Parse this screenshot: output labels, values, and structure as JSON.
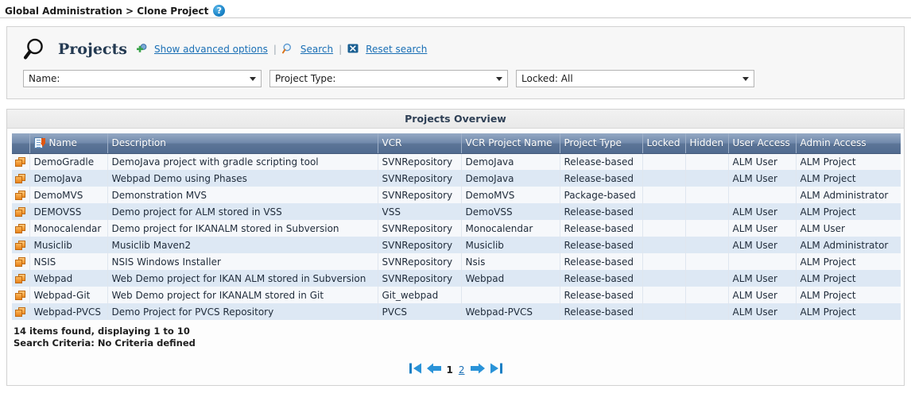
{
  "breadcrumb": {
    "text": "Global Administration > Clone Project",
    "help_icon": "help-icon",
    "help_glyph": "?"
  },
  "search_panel": {
    "icon": "magnifier-icon",
    "title": "Projects",
    "advanced_link": "Show advanced options",
    "advanced_icon": "add-options-icon",
    "separator": "|",
    "search_link": "Search",
    "search_icon": "search-icon",
    "reset_link": "Reset search",
    "reset_icon": "reset-icon",
    "filters": [
      {
        "name": "name-filter",
        "value": "Name:"
      },
      {
        "name": "project-type-filter",
        "value": "Project Type:"
      },
      {
        "name": "locked-filter",
        "value": "Locked: All"
      }
    ]
  },
  "results": {
    "title": "Projects Overview",
    "columns": [
      "",
      "Name",
      "Description",
      "VCR",
      "VCR Project Name",
      "Project Type",
      "Locked",
      "Hidden",
      "User Access",
      "Admin Access"
    ],
    "sort_column": "Name",
    "sort_icon": "sort-descending-icon",
    "row_icon": "clone-project-icon",
    "rows": [
      {
        "name": "DemoGradle",
        "description": "DemoJava project with gradle scripting tool",
        "vcr": "SVNRepository",
        "vcr_project_name": "DemoJava",
        "project_type": "Release-based",
        "locked": "",
        "hidden": "",
        "user_access": "ALM User",
        "admin_access": "ALM Project"
      },
      {
        "name": "DemoJava",
        "description": "Webpad Demo using Phases",
        "vcr": "SVNRepository",
        "vcr_project_name": "DemoJava",
        "project_type": "Release-based",
        "locked": "",
        "hidden": "",
        "user_access": "ALM User",
        "admin_access": "ALM Project"
      },
      {
        "name": "DemoMVS",
        "description": "Demonstration MVS",
        "vcr": "SVNRepository",
        "vcr_project_name": "DemoMVS",
        "project_type": "Package-based",
        "locked": "",
        "hidden": "",
        "user_access": "",
        "admin_access": "ALM Administrator"
      },
      {
        "name": "DEMOVSS",
        "description": "Demo project for ALM stored in VSS",
        "vcr": "VSS",
        "vcr_project_name": "DemoVSS",
        "project_type": "Release-based",
        "locked": "",
        "hidden": "",
        "user_access": "ALM User",
        "admin_access": "ALM Project"
      },
      {
        "name": "Monocalendar",
        "description": "Demo project for IKANALM stored in Subversion",
        "vcr": "SVNRepository",
        "vcr_project_name": "Monocalendar",
        "project_type": "Release-based",
        "locked": "",
        "hidden": "",
        "user_access": "ALM User",
        "admin_access": "ALM User"
      },
      {
        "name": "Musiclib",
        "description": "Musiclib Maven2",
        "vcr": "SVNRepository",
        "vcr_project_name": "Musiclib",
        "project_type": "Release-based",
        "locked": "",
        "hidden": "",
        "user_access": "ALM User",
        "admin_access": "ALM Administrator"
      },
      {
        "name": "NSIS",
        "description": "NSIS Windows Installer",
        "vcr": "SVNRepository",
        "vcr_project_name": "Nsis",
        "project_type": "Release-based",
        "locked": "",
        "hidden": "",
        "user_access": "",
        "admin_access": "ALM Project"
      },
      {
        "name": "Webpad",
        "description": "Web Demo project for IKAN ALM stored in Subversion",
        "vcr": "SVNRepository",
        "vcr_project_name": "Webpad",
        "project_type": "Release-based",
        "locked": "",
        "hidden": "",
        "user_access": "ALM User",
        "admin_access": "ALM Project"
      },
      {
        "name": "Webpad-Git",
        "description": "Web Demo project for IKANALM stored in Git",
        "vcr": "Git_webpad",
        "vcr_project_name": "",
        "project_type": "Release-based",
        "locked": "",
        "hidden": "",
        "user_access": "ALM User",
        "admin_access": "ALM Project"
      },
      {
        "name": "Webpad-PVCS",
        "description": "Demo Project for PVCS Repository",
        "vcr": "PVCS",
        "vcr_project_name": "Webpad-PVCS",
        "project_type": "Release-based",
        "locked": "",
        "hidden": "",
        "user_access": "ALM User",
        "admin_access": "ALM Project"
      }
    ],
    "footer": {
      "items_found": "14 items found, displaying 1 to 10",
      "search_criteria": "Search Criteria: No Criteria defined"
    },
    "pager": {
      "first_icon": "first-page-icon",
      "prev_icon": "previous-page-icon",
      "next_icon": "next-page-icon",
      "last_icon": "last-page-icon",
      "current_page": "1",
      "pages": [
        "1",
        "2"
      ],
      "page_link": "2"
    }
  },
  "colors": {
    "link": "#1a6fb5",
    "header_gradient_top": "#95a9c4",
    "header_gradient_bottom": "#516b90",
    "row_odd": "#f6f8fb",
    "row_even": "#dde8f4",
    "icon_orange": "#ef8f22"
  }
}
